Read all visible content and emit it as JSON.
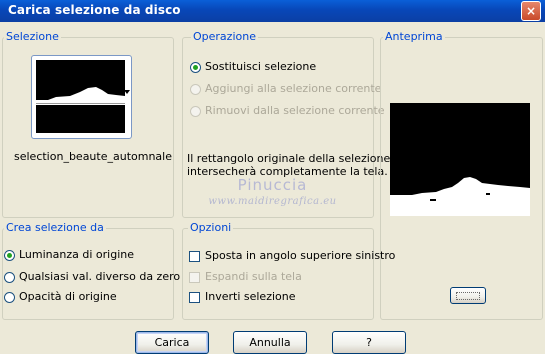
{
  "window": {
    "title": "Carica selezione da disco",
    "close_label": "×"
  },
  "selection_group": {
    "legend": "Selezione",
    "file_name": "selection_beaute_automnale"
  },
  "operation_group": {
    "legend": "Operazione",
    "options": [
      {
        "label": "Sostituisci selezione",
        "selected": true,
        "enabled": true
      },
      {
        "label": "Aggiungi alla selezione corrente",
        "selected": false,
        "enabled": false
      },
      {
        "label": "Rimuovi dalla selezione corrente",
        "selected": false,
        "enabled": false
      }
    ],
    "info_line1": "Il rettangolo originale della selezione",
    "info_line2": "intersecherà completamente la tela."
  },
  "preview_group": {
    "legend": "Anteprima"
  },
  "create_from_group": {
    "legend": "Crea selezione da",
    "options": [
      {
        "label": "Luminanza di origine",
        "selected": true
      },
      {
        "label": "Qualsiasi val. diverso da zero",
        "selected": false
      },
      {
        "label": "Opacità di origine",
        "selected": false
      }
    ]
  },
  "options_group": {
    "legend": "Opzioni",
    "checks": [
      {
        "label": "Sposta in angolo superiore sinistro",
        "checked": false,
        "enabled": true
      },
      {
        "label": "Espandi sulla tela",
        "checked": false,
        "enabled": false
      },
      {
        "label": "Inverti selezione",
        "checked": false,
        "enabled": true
      }
    ]
  },
  "watermark": {
    "line1": "Pinuccia",
    "line2": "www.maidiregrafica.eu"
  },
  "buttons": {
    "load": "Carica",
    "cancel": "Annulla",
    "help": "?"
  },
  "colors": {
    "titlebar": "#0847b8",
    "legend_text": "#0046d5",
    "radio_dot": "#21a121",
    "face": "#ece9d8"
  }
}
